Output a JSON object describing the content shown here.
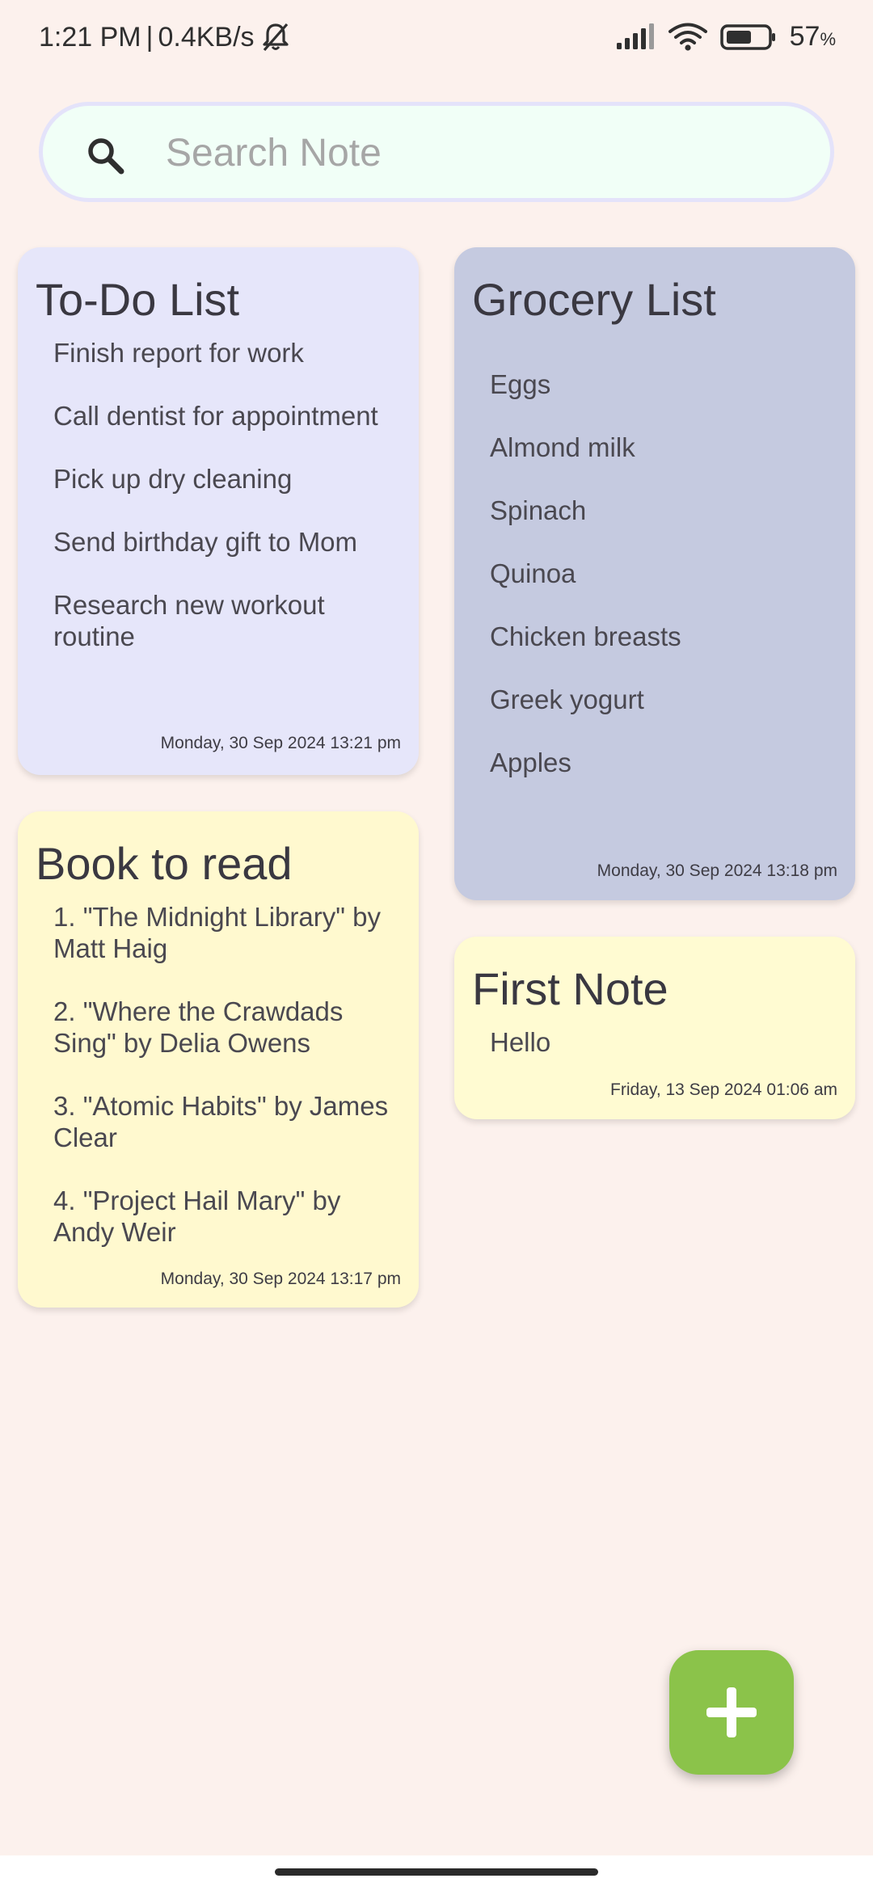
{
  "status_bar": {
    "time": "1:21 PM",
    "separator": "|",
    "network_speed": "0.4KB/s",
    "battery_percent": "57",
    "battery_unit": "%",
    "icons": [
      "mute-notification-icon",
      "signal-icon",
      "wifi-icon",
      "battery-icon"
    ]
  },
  "search": {
    "placeholder": "Search Note",
    "value": ""
  },
  "notes": {
    "todo": {
      "title": "To-Do List",
      "lines": [
        "Finish report for work",
        "Call dentist for appointment",
        "Pick up dry cleaning",
        "Send birthday gift to Mom",
        "Research new workout routine"
      ],
      "date": "Monday, 30 Sep 2024 13:21 pm",
      "color": "#e6e6fa"
    },
    "grocery": {
      "title": "Grocery List",
      "lines": [
        "Eggs",
        "Almond milk",
        "Spinach",
        "Quinoa",
        "Chicken breasts",
        "Greek yogurt",
        "Apples"
      ],
      "date": "Monday, 30 Sep 2024 13:18 pm",
      "color": "#c5cae0"
    },
    "books": {
      "title": "Book to read",
      "lines": [
        "1. \"The Midnight Library\" by Matt Haig",
        "2. \"Where the Crawdads Sing\" by Delia Owens",
        "3. \"Atomic Habits\" by James Clear",
        "4. \"Project Hail Mary\" by Andy Weir"
      ],
      "date": "Monday, 30 Sep 2024 13:17 pm",
      "color": "#fff9cf"
    },
    "first": {
      "title": "First Note",
      "lines": [
        "Hello"
      ],
      "date": "Friday, 13 Sep 2024 01:06 am",
      "color": "#fffbd2"
    }
  },
  "fab": {
    "icon": "plus-icon",
    "color": "#8bc34a"
  }
}
